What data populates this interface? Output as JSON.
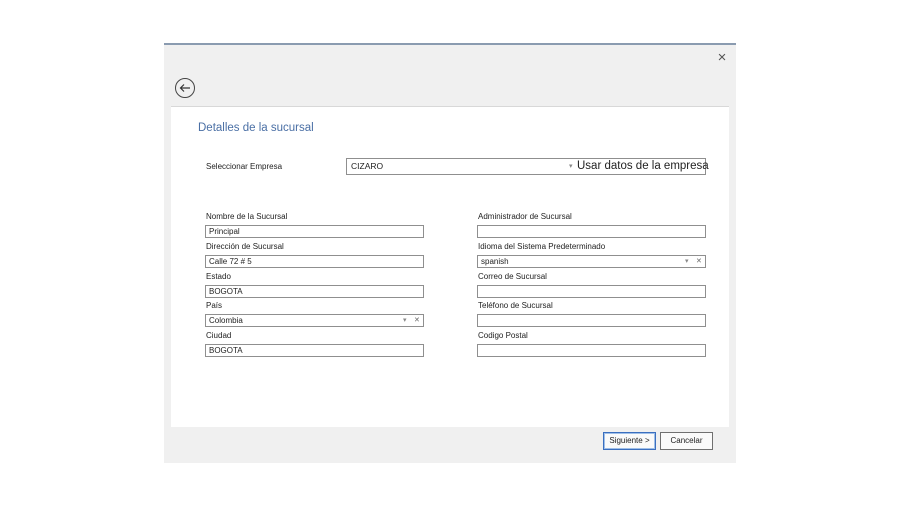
{
  "dialog": {
    "close_label": "×"
  },
  "section_title": "Detalles de la sucursal",
  "empresa": {
    "label": "Seleccionar Empresa",
    "value": "CIZARO",
    "use_company_data": "Usar datos de la empresa"
  },
  "left_fields": {
    "nombre": {
      "label": "Nombre de la Sucursal",
      "value": "Principal"
    },
    "direccion": {
      "label": "Dirección de Sucursal",
      "value": "Calle 72 # 5"
    },
    "estado": {
      "label": "Estado",
      "value": "BOGOTA"
    },
    "pais": {
      "label": "País",
      "value": "Colombia"
    },
    "ciudad": {
      "label": "Ciudad",
      "value": "BOGOTA"
    }
  },
  "right_fields": {
    "administrador": {
      "label": "Administrador de Sucursal",
      "value": ""
    },
    "idioma": {
      "label": "Idioma del Sistema Predeterminado",
      "value": "spanish"
    },
    "correo": {
      "label": "Correo de Sucursal",
      "value": ""
    },
    "telefono": {
      "label": "Teléfono de Sucursal",
      "value": ""
    },
    "postal": {
      "label": "Codigo Postal",
      "value": ""
    }
  },
  "select_controls": {
    "dropdown_glyph": "▾",
    "clear_glyph": "✕"
  },
  "footer": {
    "next_label": "Siguiente >",
    "cancel_label": "Cancelar"
  },
  "icons": {
    "back": "back-arrow-icon",
    "close": "close-icon"
  }
}
